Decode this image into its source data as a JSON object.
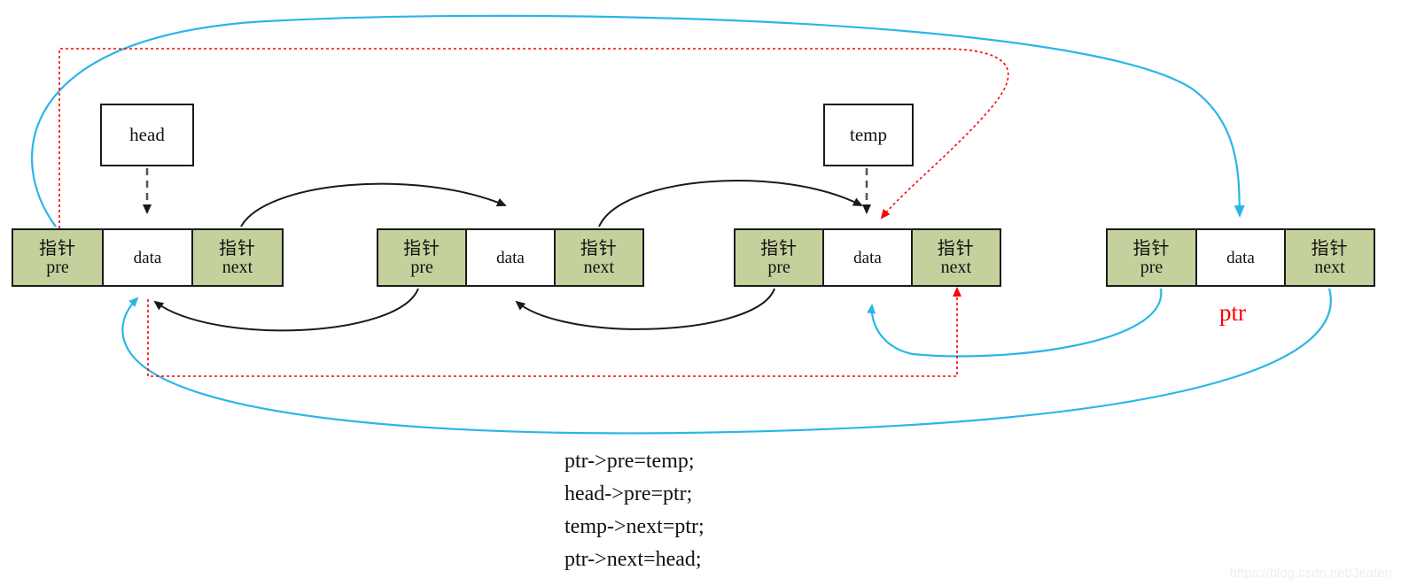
{
  "diagram": {
    "title": "doubly circular linked list insertion",
    "colors": {
      "node_pointer_fill": "#c5d19c",
      "node_data_fill": "#ffffff",
      "node_border": "#1a1a1a",
      "black_edge": "#1a1a1a",
      "cyan_edge": "#29b6e8",
      "red_edge": "#ff0000",
      "ptr_label": "#ff0000",
      "watermark": "#eceff1"
    },
    "nodes": [
      {
        "id": "node-1",
        "pre": {
          "cn": "指针",
          "en": "pre"
        },
        "data": {
          "en": "data"
        },
        "next": {
          "cn": "指针",
          "en": "next"
        }
      },
      {
        "id": "node-2",
        "pre": {
          "cn": "指针",
          "en": "pre"
        },
        "data": {
          "en": "data"
        },
        "next": {
          "cn": "指针",
          "en": "next"
        }
      },
      {
        "id": "node-3",
        "pre": {
          "cn": "指针",
          "en": "pre"
        },
        "data": {
          "en": "data"
        },
        "next": {
          "cn": "指针",
          "en": "next"
        }
      },
      {
        "id": "node-4",
        "pre": {
          "cn": "指针",
          "en": "pre"
        },
        "data": {
          "en": "data"
        },
        "next": {
          "cn": "指针",
          "en": "next"
        }
      }
    ],
    "variables": [
      {
        "id": "head-box",
        "label": "head"
      },
      {
        "id": "temp-box",
        "label": "temp"
      }
    ],
    "labels": {
      "ptr": "ptr"
    },
    "code": {
      "lines": [
        "ptr->pre=temp;",
        "head->pre=ptr;",
        "temp->next=ptr;",
        "ptr->next=head;"
      ]
    },
    "watermark": "https://blog.csdn.net/Jeaten"
  }
}
